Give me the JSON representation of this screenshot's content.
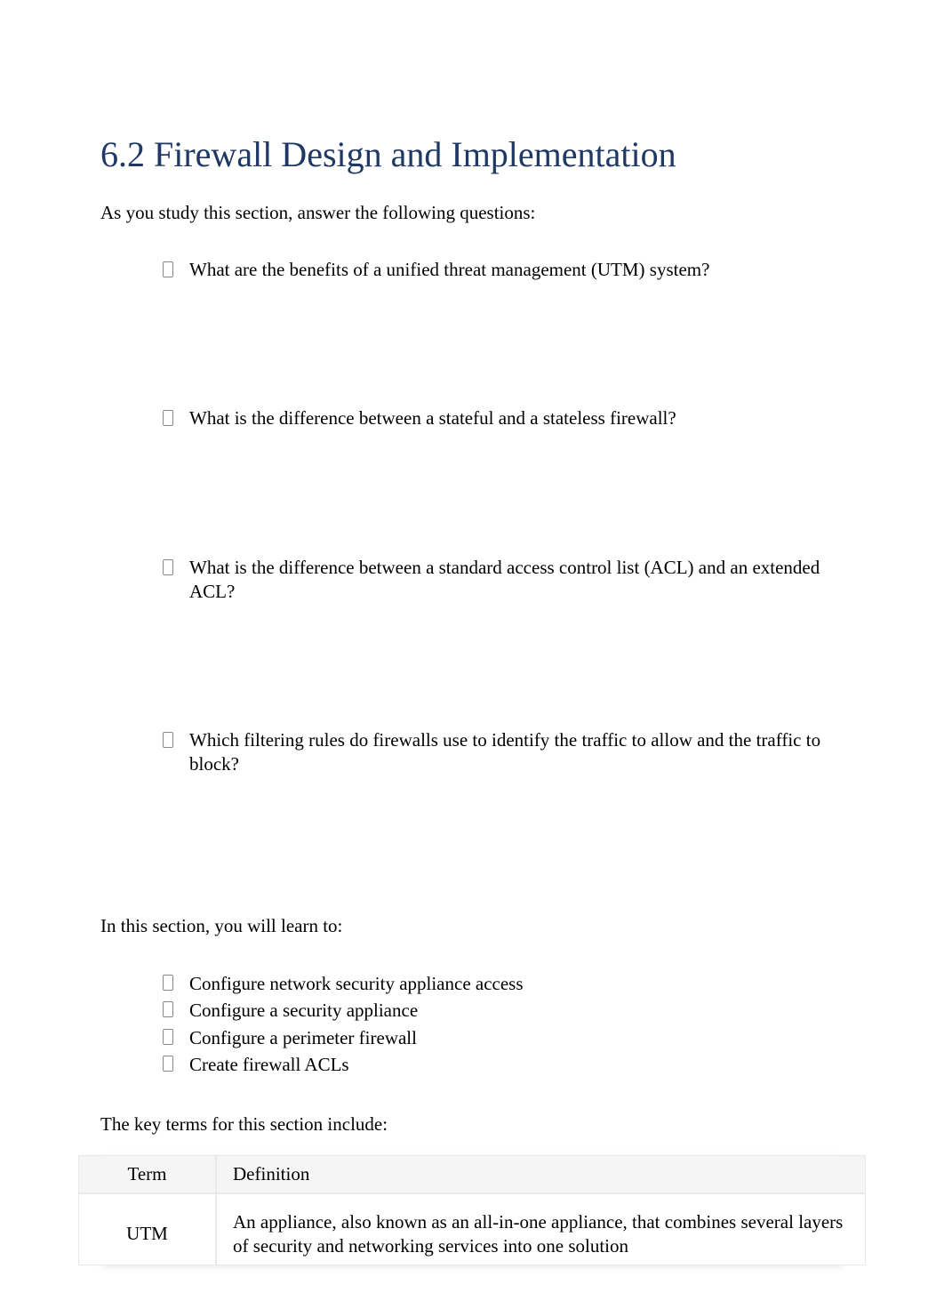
{
  "heading": "6.2 Firewall Design and Implementation",
  "intro": "As you study this section, answer the following questions:",
  "questions": [
    "What are the benefits of a unified threat management (UTM) system?",
    "What is the difference between a stateful and a stateless firewall?",
    "What is the difference between a standard access control list (ACL) and an extended ACL?",
    "Which filtering rules do firewalls use to identify the traffic to allow and the traffic to block?"
  ],
  "learn_intro": "In this section, you will learn to:",
  "learn_items": [
    "Configure network security appliance access",
    "Configure a security appliance",
    "Configure a perimeter firewall",
    "Create firewall ACLs"
  ],
  "key_terms_intro": "The key terms for this section include:",
  "table": {
    "headers": {
      "term": "Term",
      "definition": "Definition"
    },
    "rows": [
      {
        "term": "UTM",
        "definition": "An appliance, also known as an all-in-one appliance, that combines several layers of security and networking services into one solution"
      }
    ]
  }
}
